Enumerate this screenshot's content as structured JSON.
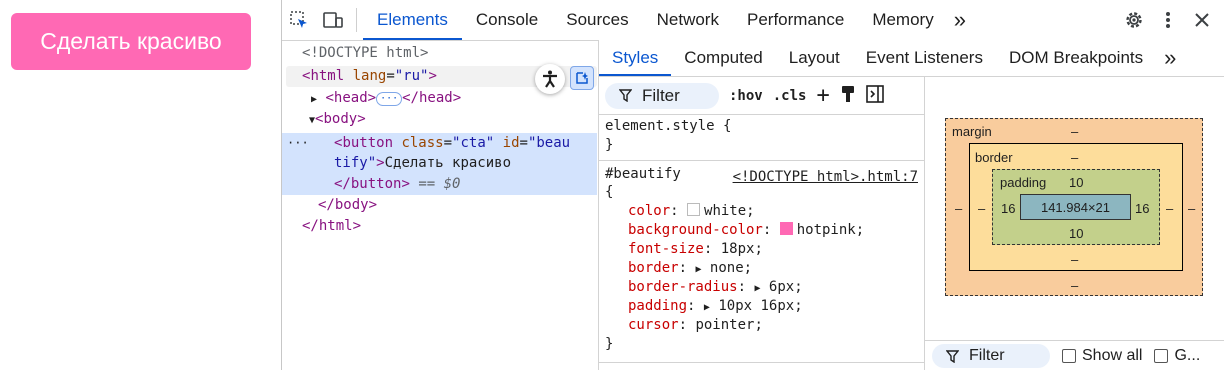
{
  "page": {
    "cta_label": "Сделать красиво"
  },
  "topbar": {
    "tabs": [
      "Elements",
      "Console",
      "Sources",
      "Network",
      "Performance",
      "Memory"
    ],
    "more": "»"
  },
  "dom": {
    "doctype": "<!DOCTYPE html>",
    "html_tag": "html",
    "html_attr": "lang",
    "html_val": "\"ru\"",
    "head_tag": "head",
    "body_tag": "body",
    "button_tag": "button",
    "btn_class_attr": "class",
    "btn_class_val": "\"cta\"",
    "btn_id_attr": "id",
    "btn_id_val_1": "\"beau",
    "btn_id_val_2": "tify\"",
    "btn_text": "Сделать красиво",
    "eq_dollar": "== $0",
    "dots": "···"
  },
  "styles": {
    "subtabs": [
      "Styles",
      "Computed",
      "Layout",
      "Event Listeners",
      "DOM Breakpoints"
    ],
    "filter_label": "Filter",
    "hov": ":hov",
    "cls": ".cls",
    "element_style": "element.style {",
    "close_brace": "}",
    "selector": "#beautify",
    "source": "<!DOCTYPE html>.html:7",
    "open_brace": "{",
    "props": [
      {
        "name": "color",
        "value": "white",
        "swatch": "#ffffff"
      },
      {
        "name": "background-color",
        "value": "hotpink",
        "swatch": "#ff69b4"
      },
      {
        "name": "font-size",
        "value": "18px"
      },
      {
        "name": "border",
        "value": "none",
        "expand": true
      },
      {
        "name": "border-radius",
        "value": "6px",
        "expand": true
      },
      {
        "name": "padding",
        "value": "10px 16px",
        "expand": true
      },
      {
        "name": "cursor",
        "value": "pointer"
      }
    ]
  },
  "box_model": {
    "margin_label": "margin",
    "margin_top": "–",
    "margin_bottom": "–",
    "margin_left": "–",
    "margin_right": "–",
    "border_label": "border",
    "border_top": "–",
    "border_bottom": "–",
    "border_left": "–",
    "border_right": "–",
    "padding_label": "padding",
    "padding_top": "10",
    "padding_bottom": "10",
    "padding_left": "16",
    "padding_right": "16",
    "content": "141.984×21"
  },
  "computed_filter": {
    "label": "Filter",
    "show_all": "Show all",
    "group": "G..."
  },
  "colors": {
    "accent": "#0b57d0",
    "hotpink": "#ff69b4",
    "selection": "#d3e3fd"
  }
}
